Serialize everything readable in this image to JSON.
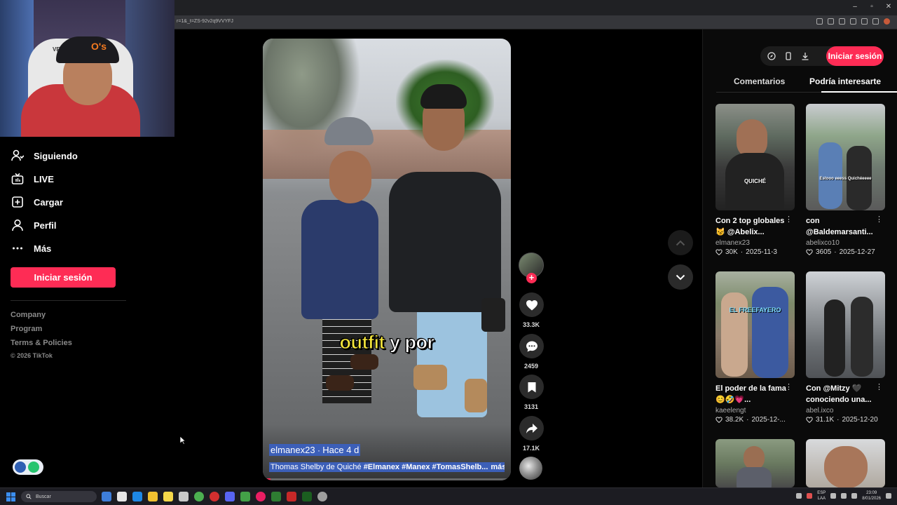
{
  "browser": {
    "url": "r=1&_t=ZS-92v2q9VVYFJ",
    "controls": [
      "–",
      "▫",
      "✕"
    ]
  },
  "webcam": {
    "chair_text": "VERTA",
    "cap_logo": "O's"
  },
  "sidebar": {
    "items": [
      {
        "label": "Siguiendo",
        "icon": "following-icon"
      },
      {
        "label": "LIVE",
        "icon": "live-icon"
      },
      {
        "label": "Cargar",
        "icon": "upload-icon"
      },
      {
        "label": "Perfil",
        "icon": "profile-icon"
      },
      {
        "label": "Más",
        "icon": "more-icon"
      }
    ],
    "login_label": "Iniciar sesión",
    "footer": [
      "Company",
      "Program",
      "Terms & Policies"
    ],
    "copyright": "© 2026 TikTok"
  },
  "video": {
    "caption_highlight": "outfit",
    "caption_rest": " y por",
    "author": "elmanex23",
    "time_sep": " · ",
    "time": "Hace 4 d",
    "desc_plain": "Thomas Shelby de Quiché ",
    "desc_tags": "#Elmanex #Manex #TomasShelb...",
    "more": "más",
    "progress": 0.03
  },
  "actions": {
    "likes": "33.3K",
    "comments": "2459",
    "saves": "3131",
    "shares": "17.1K"
  },
  "right_panel": {
    "login_label": "Iniciar sesión",
    "tabs": [
      "Comentarios",
      "Podría interesarte"
    ],
    "active_tab": 1,
    "cards": [
      {
        "title": "Con 2 top globales 😼 @Abelix...",
        "author": "elmanex23",
        "likes": "30K",
        "date": "2025-11-3",
        "tag": "QUICHÉ"
      },
      {
        "title": "con @Baldemarsanti...",
        "author": "abelixco10",
        "likes": "3605",
        "date": "2025-12-27",
        "tag": "Estooo eeess Quichéeeee"
      },
      {
        "title": "El poder de la fama 😊🤣💗...",
        "author": "kaeelengt",
        "likes": "38.2K",
        "date": "2025-12-...",
        "tag": "EL FREEFAYERO"
      },
      {
        "title": "Con @Mitzy 🖤 conociendo una...",
        "author": "abel.ixco",
        "likes": "31.1K",
        "date": "2025-12-20",
        "tag": ""
      },
      {
        "title": "",
        "author": "",
        "likes": "",
        "date": "",
        "tag": ""
      },
      {
        "title": "",
        "author": "",
        "likes": "",
        "date": "",
        "tag": ""
      }
    ]
  },
  "taskbar": {
    "search_placeholder": "Buscar",
    "lang": "ESP",
    "lang2": "LAA",
    "time": "23:09",
    "date": "8/01/2026"
  },
  "colors": {
    "accent": "#fe2c55",
    "highlight": "#3c5fb8",
    "caption_yellow": "#f5e63b"
  }
}
